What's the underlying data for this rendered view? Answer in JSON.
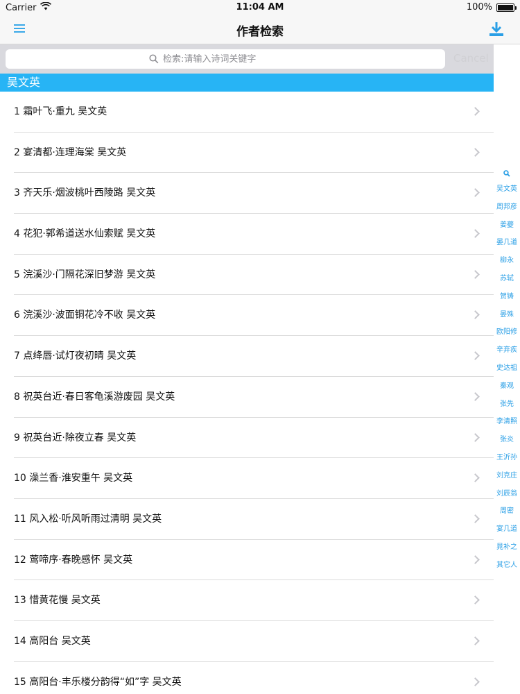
{
  "status_bar": {
    "carrier": "Carrier",
    "time": "11:04 AM",
    "battery": "100%",
    "battery_level": 1.0
  },
  "nav": {
    "title": "作者检索"
  },
  "search": {
    "placeholder": "检索:请输入诗词关键字",
    "cancel_label": "Cancel"
  },
  "section": {
    "title": "吴文英"
  },
  "list": [
    {
      "label": "1 霜叶飞·重九  吴文英"
    },
    {
      "label": "2 宴清都·连理海棠  吴文英"
    },
    {
      "label": "3 齐天乐·烟波桃叶西陵路  吴文英"
    },
    {
      "label": "4 花犯·郭希道送水仙索赋  吴文英"
    },
    {
      "label": "5 浣溪沙·门隔花深旧梦游  吴文英"
    },
    {
      "label": "6 浣溪沙·波面铜花冷不收  吴文英"
    },
    {
      "label": "7 点绛唇·试灯夜初晴  吴文英"
    },
    {
      "label": "8 祝英台近·春日客龟溪游废园  吴文英"
    },
    {
      "label": "9 祝英台近·除夜立春  吴文英"
    },
    {
      "label": "10 澡兰香·淮安重午  吴文英"
    },
    {
      "label": "11 风入松·听风听雨过清明  吴文英"
    },
    {
      "label": "12 莺啼序·春晚感怀  吴文英"
    },
    {
      "label": "13 惜黄花慢  吴文英"
    },
    {
      "label": "14 高阳台  吴文英"
    },
    {
      "label": "15 高阳台·丰乐楼分韵得“如”字  吴文英"
    }
  ],
  "index": [
    "吴文英",
    "周邦彦",
    "姜夔",
    "晏几道",
    "柳永",
    "苏轼",
    "贺铸",
    "晏殊",
    "欧阳修",
    "辛弃疾",
    "史达祖",
    "秦观",
    "张先",
    "李清照",
    "张炎",
    "王沂孙",
    "刘克庄",
    "刘辰翁",
    "周密",
    "宴几道",
    "晁补之",
    "其它人"
  ],
  "colors": {
    "accent": "#27b4f5",
    "link": "#2a9fe6"
  }
}
